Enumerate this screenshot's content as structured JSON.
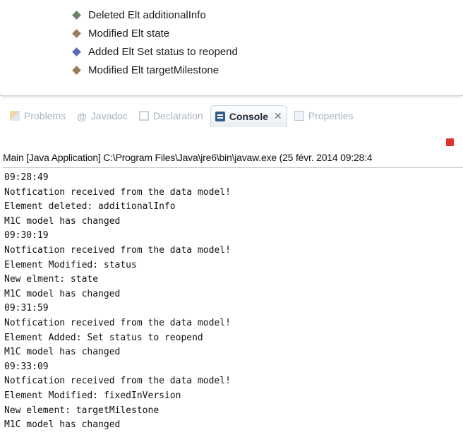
{
  "tree": {
    "items": [
      {
        "kind": "deleted",
        "label": "Deleted Elt additionalInfo"
      },
      {
        "kind": "modified",
        "label": "Modified Elt state"
      },
      {
        "kind": "added",
        "label": "Added Elt Set status to reopend"
      },
      {
        "kind": "modified",
        "label": "Modified Elt targetMilestone"
      }
    ]
  },
  "tabs": [
    {
      "label": "Problems",
      "icon": "problems-icon",
      "active": false
    },
    {
      "label": "Javadoc",
      "icon": "javadoc-icon",
      "active": false
    },
    {
      "label": "Declaration",
      "icon": "declaration-icon",
      "active": false
    },
    {
      "label": "Console",
      "icon": "console-icon",
      "active": true,
      "close": "✕"
    },
    {
      "label": "Properties",
      "icon": "properties-icon",
      "active": false
    }
  ],
  "console": {
    "header": "Main [Java Application] C:\\Program Files\\Java\\jre6\\bin\\javaw.exe (25 févr. 2014 09:28:4",
    "lines": [
      "09:28:49",
      "Notfication received from the data model!",
      "Element deleted: additionalInfo",
      "M1C model has changed",
      "09:30:19",
      "Notfication received from the data model!",
      "Element Modified: status",
      "New elment: state",
      "M1C model has changed",
      "09:31:59",
      "Notfication received from the data model!",
      "Element Added: Set status to reopend",
      "M1C model has changed",
      "09:33:09",
      "Notfication received from the data model!",
      "Element Modified: fixedInVersion",
      "New element: targetMilestone",
      "M1C model has changed"
    ]
  },
  "colors": {
    "stop_button": "#e0322f",
    "active_tab_text": "#1f2a35",
    "inactive_tab_text": "#a9b2bd"
  }
}
